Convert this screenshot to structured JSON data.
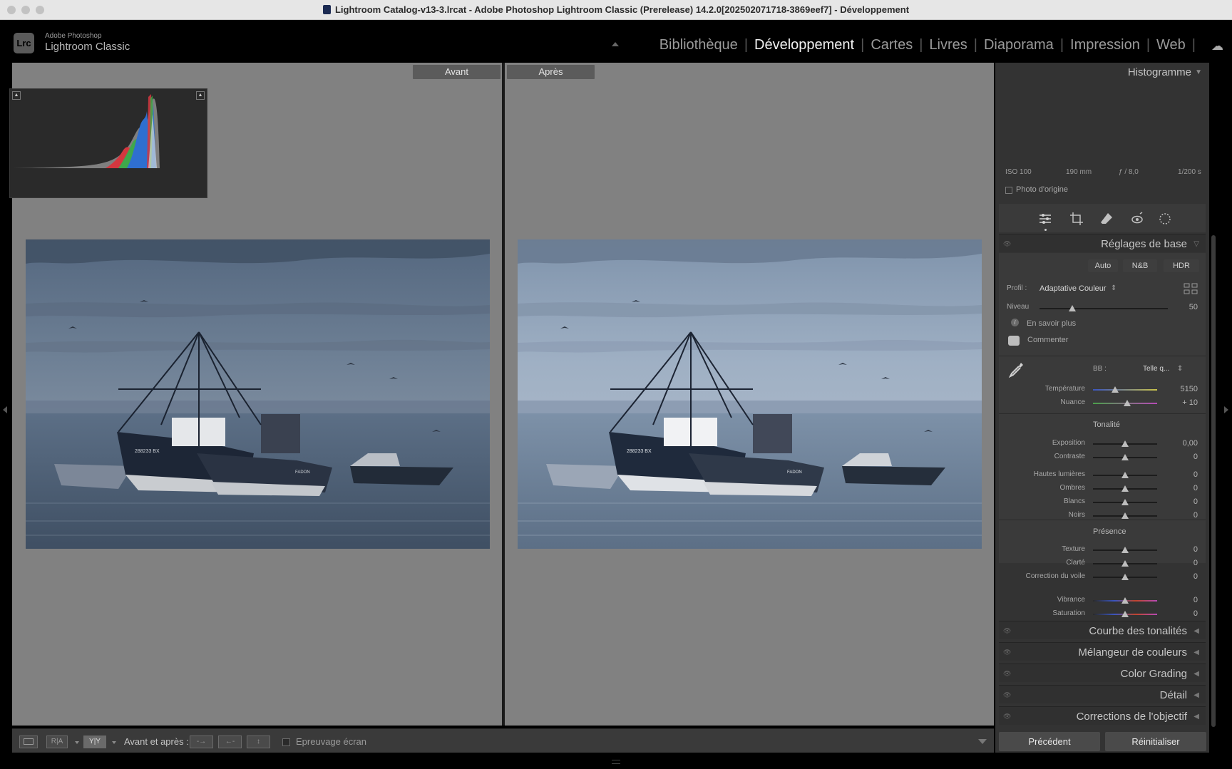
{
  "window": {
    "title": "Lightroom Catalog-v13-3.lrcat - Adobe Photoshop Lightroom Classic (Prerelease) 14.2.0[202502071718-3869eef7] - Développement"
  },
  "brand": {
    "logo": "Lrc",
    "line1": "Adobe Photoshop",
    "line2": "Lightroom Classic"
  },
  "modules": [
    "Bibliothèque",
    "Développement",
    "Cartes",
    "Livres",
    "Diaporama",
    "Impression",
    "Web"
  ],
  "active_module": "Développement",
  "view": {
    "before_label": "Avant",
    "after_label": "Après",
    "boat_number": "288233 BX",
    "boat_name": "FADON"
  },
  "toolbar": {
    "before_after_label": "Avant et après :",
    "softproof_label": "Epreuvage écran"
  },
  "histogram": {
    "title": "Histogramme",
    "iso": "ISO 100",
    "focal": "190 mm",
    "aperture": "ƒ / 8,0",
    "shutter": "1/200 s",
    "original_photo": "Photo d'origine"
  },
  "basic": {
    "title": "Réglages de base",
    "buttons": [
      "Auto",
      "N&B",
      "HDR"
    ],
    "profile_label": "Profil :",
    "profile_value": "Adaptative Couleur",
    "level_label": "Niveau",
    "level_value": "50",
    "learn_more": "En savoir plus",
    "comment": "Commenter",
    "wb_label": "BB :",
    "wb_value": "Telle q...",
    "temp_label": "Température",
    "temp_value": "5150",
    "tint_label": "Nuance",
    "tint_value": "+ 10",
    "tone_header": "Tonalité",
    "presence_header": "Présence",
    "sliders": [
      {
        "label": "Exposition",
        "value": "0,00"
      },
      {
        "label": "Contraste",
        "value": "0"
      },
      {
        "label": "Hautes lumières",
        "value": "0"
      },
      {
        "label": "Ombres",
        "value": "0"
      },
      {
        "label": "Blancs",
        "value": "0"
      },
      {
        "label": "Noirs",
        "value": "0"
      },
      {
        "label": "Texture",
        "value": "0"
      },
      {
        "label": "Clarté",
        "value": "0"
      },
      {
        "label": "Correction du voile",
        "value": "0"
      },
      {
        "label": "Vibrance",
        "value": "0"
      },
      {
        "label": "Saturation",
        "value": "0"
      }
    ]
  },
  "sections": [
    "Courbe des tonalités",
    "Mélangeur de couleurs",
    "Color Grading",
    "Détail",
    "Corrections de l'objectif"
  ],
  "footer": {
    "previous": "Précédent",
    "reset": "Réinitialiser"
  },
  "colors": {
    "background": "#000000",
    "view_bg": "#818181",
    "panel_bg": "#333333",
    "active_text": "#f2f2f2"
  }
}
